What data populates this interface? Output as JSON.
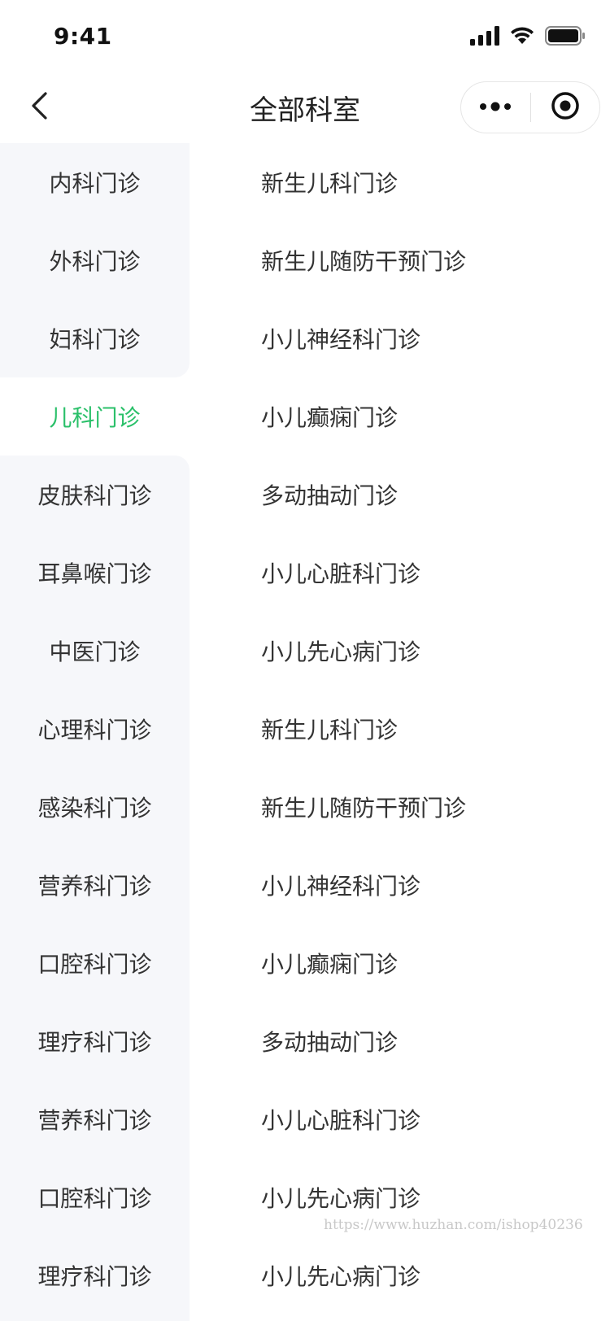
{
  "status_bar": {
    "time": "9:41",
    "icons": [
      "cellular-signal-icon",
      "wifi-icon",
      "battery-icon"
    ]
  },
  "nav": {
    "title": "全部科室",
    "back_icon": "chevron-left-icon",
    "more_icon": "more-dots-icon",
    "close_icon": "target-circle-icon"
  },
  "sidebar": {
    "active_index": 3,
    "active_color": "#2bc06a",
    "items": [
      "内科门诊",
      "外科门诊",
      "妇科门诊",
      "儿科门诊",
      "皮肤科门诊",
      "耳鼻喉门诊",
      "中医门诊",
      "心理科门诊",
      "感染科门诊",
      "营养科门诊",
      "口腔科门诊",
      "理疗科门诊",
      "营养科门诊",
      "口腔科门诊",
      "理疗科门诊"
    ]
  },
  "departments": {
    "items": [
      "新生儿科门诊",
      "新生儿随防干预门诊",
      "小儿神经科门诊",
      "小儿癫痫门诊",
      "多动抽动门诊",
      "小儿心脏科门诊",
      "小儿先心病门诊",
      "新生儿科门诊",
      "新生儿随防干预门诊",
      "小儿神经科门诊",
      "小儿癫痫门诊",
      "多动抽动门诊",
      "小儿心脏科门诊",
      "小儿先心病门诊",
      "小儿先心病门诊"
    ]
  },
  "watermark": "https://www.huzhan.com/ishop40236"
}
